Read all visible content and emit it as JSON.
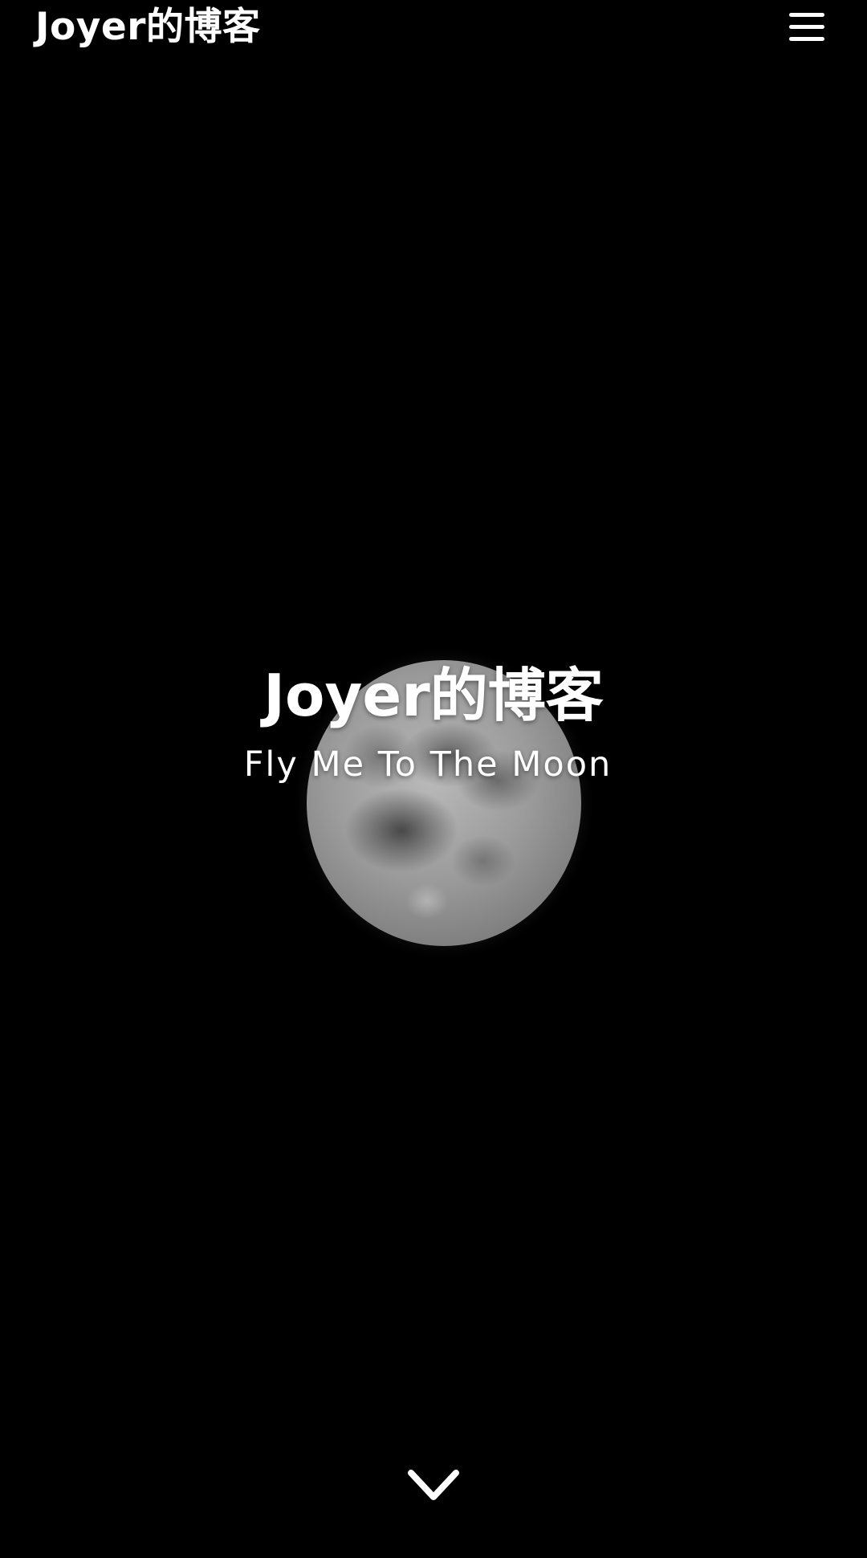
{
  "header": {
    "brand": "Joyer的博客",
    "menu_icon": "hamburger-menu-icon"
  },
  "hero": {
    "title": "Joyer的博客",
    "subtitle": "Fly Me To The Moon",
    "background_image": "moon-photo",
    "scroll_icon": "chevron-down-icon"
  },
  "colors": {
    "background": "#000000",
    "text": "#ffffff"
  }
}
